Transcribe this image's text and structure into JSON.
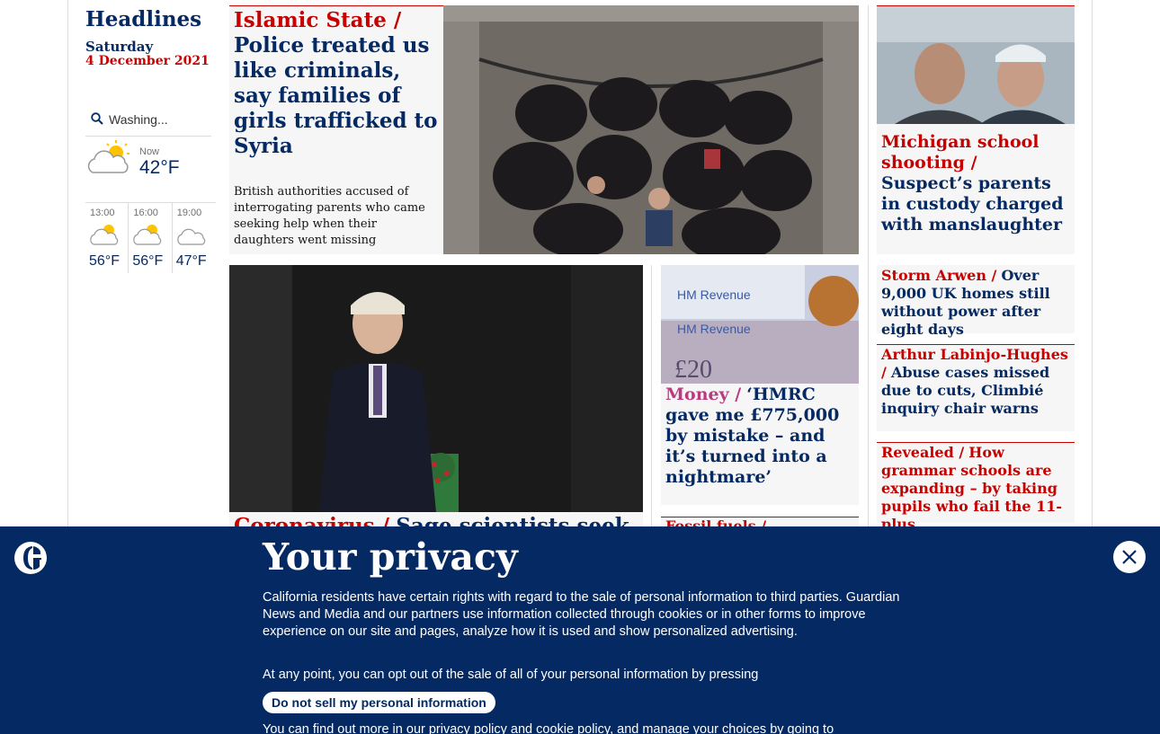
{
  "sidebar": {
    "title": "Headlines",
    "day": "Saturday",
    "date": "4 December 2021"
  },
  "weather": {
    "search_placeholder": "Washing...",
    "now_label": "Now",
    "now_temp": "42°F",
    "forecast": [
      {
        "time": "13:00",
        "temp": "56°F",
        "icon": "partly-cloudy-icon"
      },
      {
        "time": "16:00",
        "temp": "56°F",
        "icon": "partly-cloudy-icon"
      },
      {
        "time": "19:00",
        "temp": "47°F",
        "icon": "cloudy-icon"
      }
    ]
  },
  "stories": {
    "main": {
      "kicker": "Islamic State /",
      "headline": "Police treated us like criminals, say families of girls trafficked to Syria",
      "standfirst": "British authorities accused of interrogating parents who came seeking help when their daughters went missing"
    },
    "michigan": {
      "kicker": "Michigan school shooting /",
      "headline": "Suspect’s parents in custody charged with manslaughter"
    },
    "boris": {
      "kicker": "Coronavirus /",
      "headline": "Sage scientists seek"
    },
    "money": {
      "kicker": "Money /",
      "headline": "‘HMRC gave me £775,000 by mistake – and it’s turned into a nightmare’"
    },
    "fossil": {
      "kicker": "Fossil fuels /"
    },
    "storm": {
      "kicker": "Storm Arwen /",
      "headline": "Over 9,000 UK homes still without power after eight days"
    },
    "arthur": {
      "kicker": "Arthur Labinjo-Hughes /",
      "headline": "Abuse cases missed due to cuts, Climbié inquiry chair warns"
    },
    "revealed": {
      "kicker": "Revealed /",
      "headline": "How grammar schools are expanding – by taking pupils who fail the 11-plus"
    }
  },
  "privacy": {
    "title": "Your privacy",
    "para1": "California residents have certain rights with regard to the sale of personal information to third parties. Guardian News and Media and our partners use information collected through cookies or in other forms to improve experience on our site and pages, analyze how it is used and show personalized advertising.",
    "para2": "At any point, you can opt out of the sale of all of your personal information by pressing",
    "button": "Do not sell my personal information",
    "para3": "You can find out more in our privacy policy and cookie policy, and manage your choices by going to"
  },
  "colors": {
    "navy": "#052962",
    "red": "#c70000",
    "money_pink": "#bb3b80"
  }
}
